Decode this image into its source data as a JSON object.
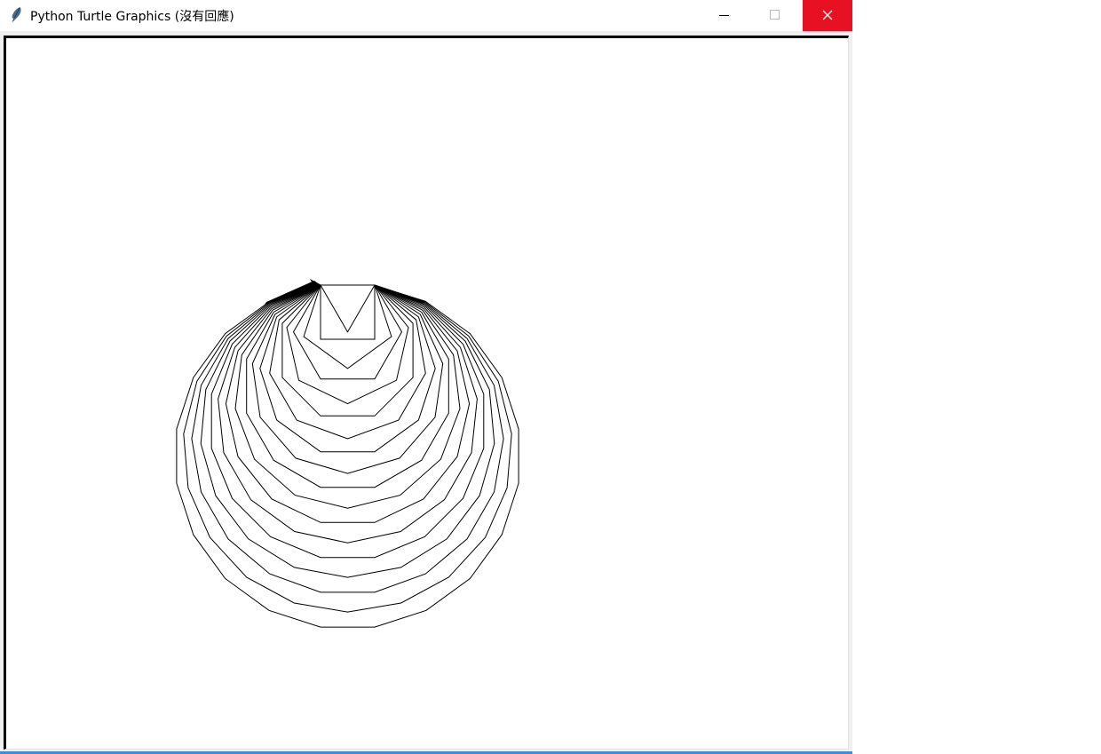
{
  "window": {
    "title": "Python Turtle Graphics (沒有回應)"
  },
  "icons": {
    "app": "feather-icon",
    "minimize": "minimize-icon",
    "maximize": "maximize-icon",
    "close": "close-icon"
  },
  "colors": {
    "close_button": "#e81123",
    "drawing_line": "#000000",
    "canvas": "#ffffff"
  },
  "canvas": {
    "drawing": "nested concentric polygons with a black turtle arrow cursor at the top"
  }
}
